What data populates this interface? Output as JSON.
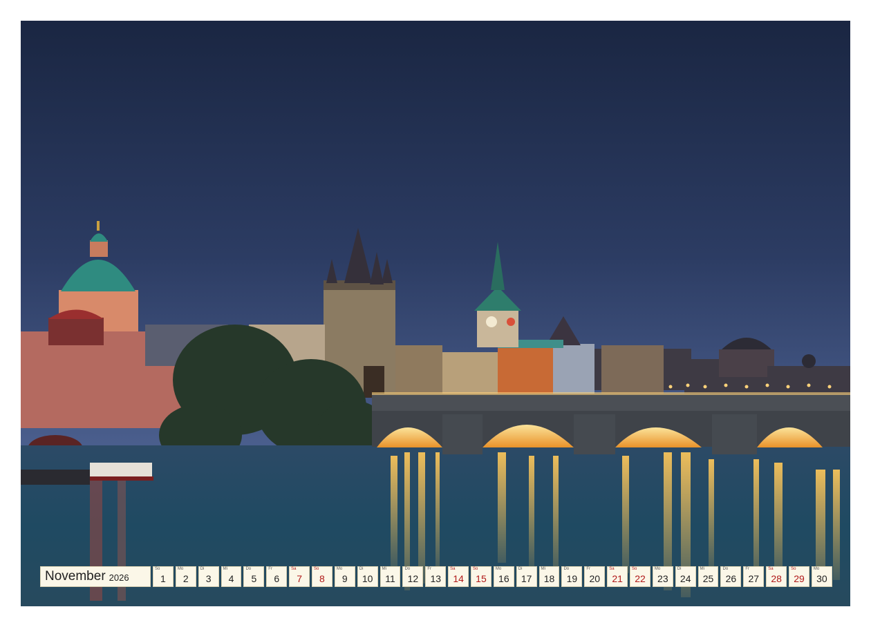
{
  "calendar": {
    "month": "November",
    "year": "2026",
    "days": [
      {
        "wd": "So",
        "num": "1",
        "weekend": false
      },
      {
        "wd": "Mo",
        "num": "2",
        "weekend": false
      },
      {
        "wd": "Di",
        "num": "3",
        "weekend": false
      },
      {
        "wd": "Mi",
        "num": "4",
        "weekend": false
      },
      {
        "wd": "Do",
        "num": "5",
        "weekend": false
      },
      {
        "wd": "Fr",
        "num": "6",
        "weekend": false
      },
      {
        "wd": "Sa",
        "num": "7",
        "weekend": true
      },
      {
        "wd": "So",
        "num": "8",
        "weekend": true
      },
      {
        "wd": "Mo",
        "num": "9",
        "weekend": false
      },
      {
        "wd": "Di",
        "num": "10",
        "weekend": false
      },
      {
        "wd": "Mi",
        "num": "11",
        "weekend": false
      },
      {
        "wd": "Do",
        "num": "12",
        "weekend": false
      },
      {
        "wd": "Fr",
        "num": "13",
        "weekend": false
      },
      {
        "wd": "Sa",
        "num": "14",
        "weekend": true
      },
      {
        "wd": "So",
        "num": "15",
        "weekend": true
      },
      {
        "wd": "Mo",
        "num": "16",
        "weekend": false
      },
      {
        "wd": "Di",
        "num": "17",
        "weekend": false
      },
      {
        "wd": "Mi",
        "num": "18",
        "weekend": false
      },
      {
        "wd": "Do",
        "num": "19",
        "weekend": false
      },
      {
        "wd": "Fr",
        "num": "20",
        "weekend": false
      },
      {
        "wd": "Sa",
        "num": "21",
        "weekend": true
      },
      {
        "wd": "So",
        "num": "22",
        "weekend": true
      },
      {
        "wd": "Mo",
        "num": "23",
        "weekend": false
      },
      {
        "wd": "Di",
        "num": "24",
        "weekend": false
      },
      {
        "wd": "Mi",
        "num": "25",
        "weekend": false
      },
      {
        "wd": "Do",
        "num": "26",
        "weekend": false
      },
      {
        "wd": "Fr",
        "num": "27",
        "weekend": false
      },
      {
        "wd": "Sa",
        "num": "28",
        "weekend": true
      },
      {
        "wd": "So",
        "num": "29",
        "weekend": true
      },
      {
        "wd": "Mo",
        "num": "30",
        "weekend": false
      }
    ]
  },
  "colors": {
    "sky_top": "#1d2a44",
    "sky_bottom": "#3a4f7c",
    "water": "#24425a",
    "lights": "#f3b34a",
    "weekend": "#b01818"
  }
}
